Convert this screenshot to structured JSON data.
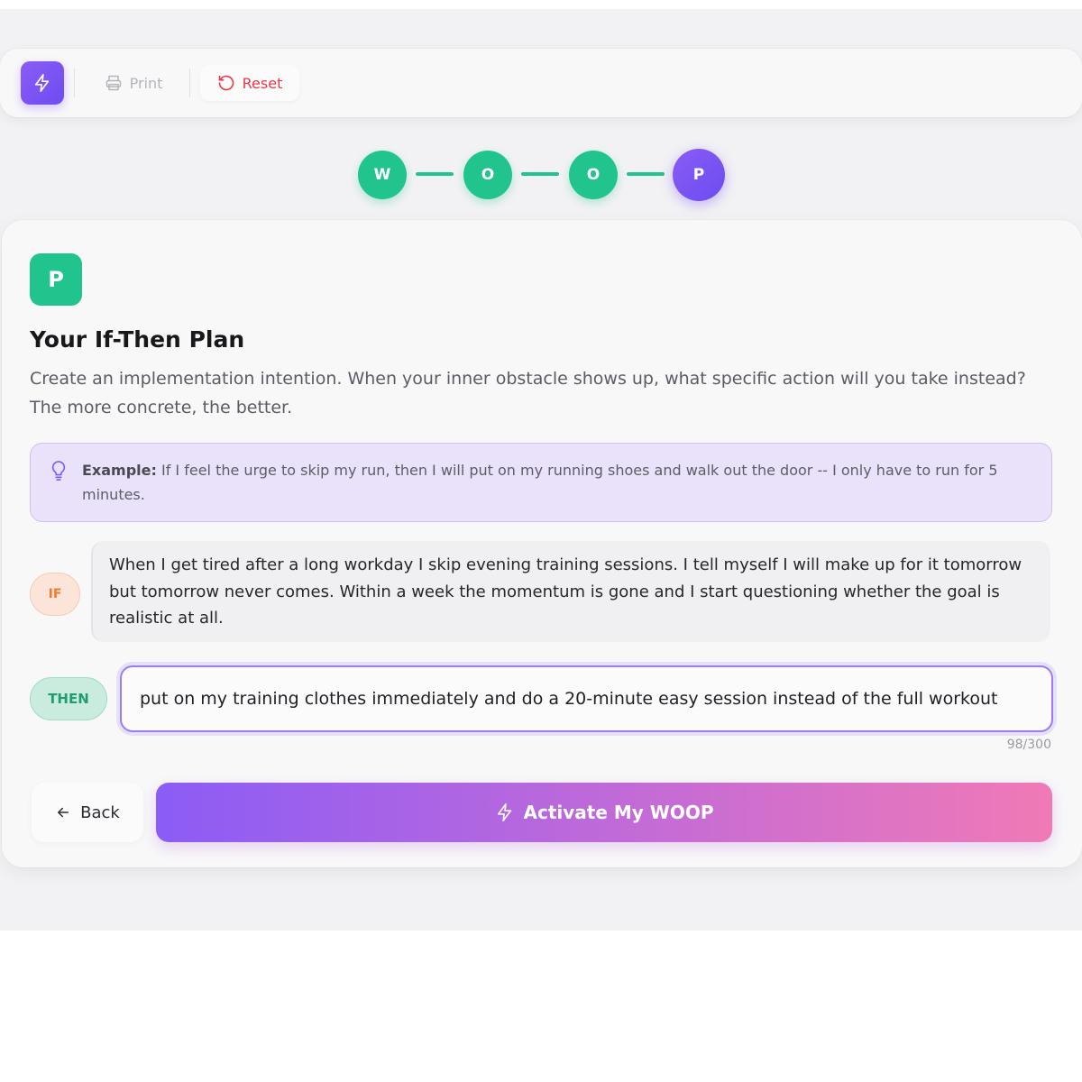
{
  "toolbar": {
    "logo_icon": "lightning-icon",
    "print_label": "Print",
    "reset_label": "Reset",
    "reset_color": "#e53946"
  },
  "stepper": {
    "steps": [
      {
        "letter": "W",
        "state": "done"
      },
      {
        "letter": "O",
        "state": "done"
      },
      {
        "letter": "O",
        "state": "done"
      },
      {
        "letter": "P",
        "state": "active"
      }
    ],
    "done_color": "#22c48e",
    "active_color": "#7c5cf5"
  },
  "card": {
    "badge": "P",
    "title": "Your If-Then Plan",
    "description": "Create an implementation intention. When your inner obstacle shows up, what specific action will you take instead? The more concrete, the better.",
    "example": {
      "icon": "lightbulb-icon",
      "label": "Example:",
      "text": " If I feel the urge to skip my run, then I will put on my running shoes and walk out the door -- I only have to run for 5 minutes."
    },
    "if_label": "IF",
    "if_text": "When I get tired after a long workday I skip evening training sessions. I tell myself I will make up for it tomorrow but tomorrow never comes. Within a week the momentum is gone and I start questioning whether the goal is realistic at all.",
    "then_label": "THEN",
    "then_value": "put on my training clothes immediately and do a 20-minute easy session instead of the full workout",
    "counter": "98/300",
    "back_label": "Back",
    "activate_label": "Activate My WOOP"
  }
}
